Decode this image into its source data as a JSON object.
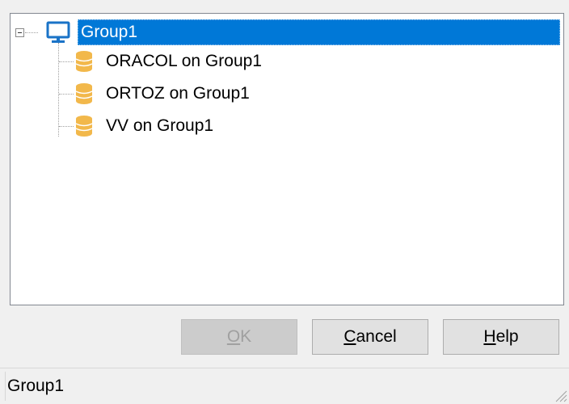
{
  "tree": {
    "root": {
      "label": "Group1",
      "icon": "computer-monitor-icon",
      "expanded": true,
      "selected": true
    },
    "children": [
      {
        "label": "ORACOL on Group1",
        "icon": "database-icon"
      },
      {
        "label": "ORTOZ on Group1",
        "icon": "database-icon"
      },
      {
        "label": "VV on Group1",
        "icon": "database-icon"
      }
    ]
  },
  "buttons": {
    "ok": {
      "mnemonic": "O",
      "rest": "K",
      "enabled": false
    },
    "cancel": {
      "mnemonic": "C",
      "rest": "ancel",
      "enabled": true
    },
    "help": {
      "mnemonic": "H",
      "rest": "elp",
      "enabled": true
    }
  },
  "status_bar": {
    "text": "Group1"
  },
  "colors": {
    "selection": "#0078d7",
    "database_icon": "#f2b84b",
    "monitor_icon": "#1a73c7"
  }
}
